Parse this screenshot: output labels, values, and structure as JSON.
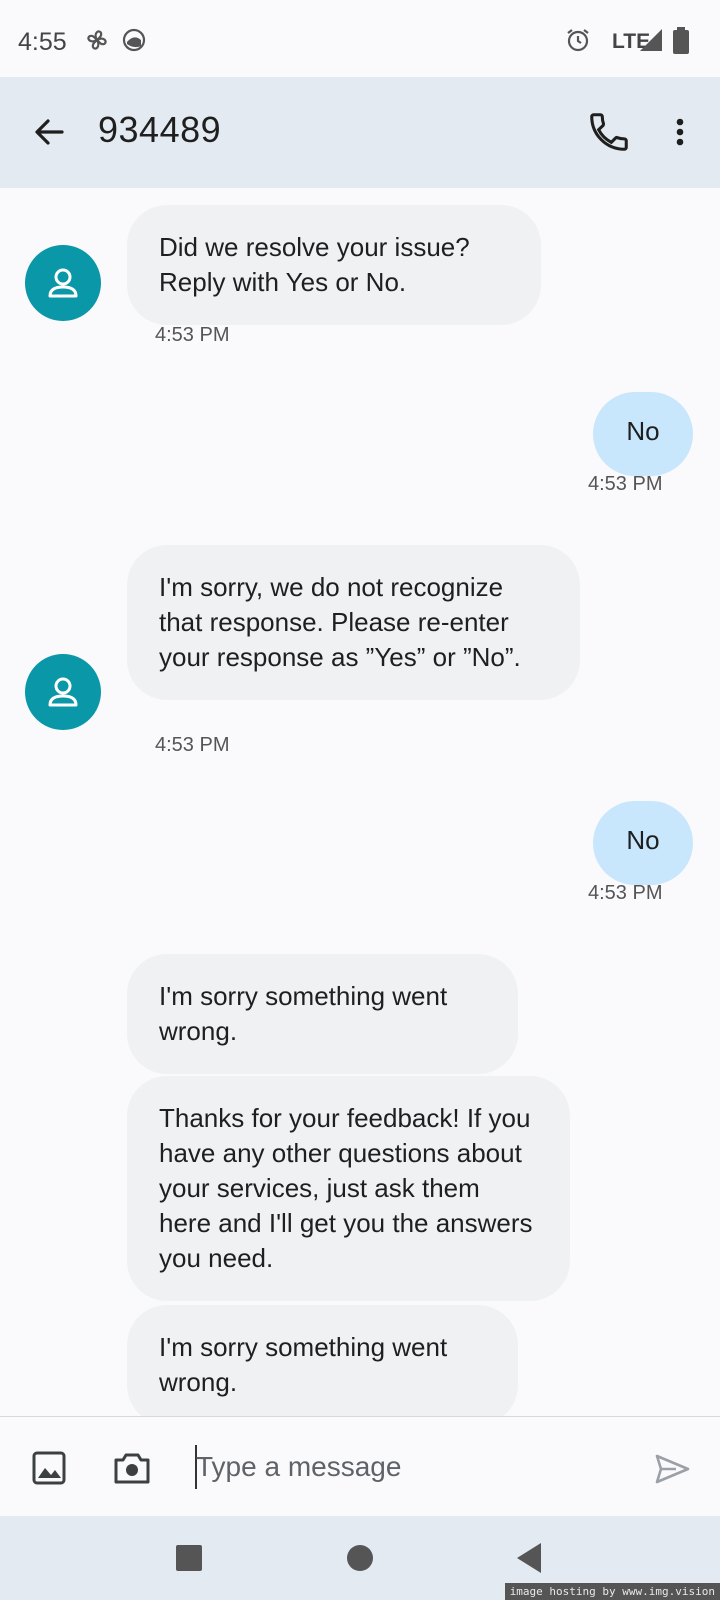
{
  "status_bar": {
    "time": "4:55",
    "network": "LTE",
    "icons": [
      "fan-icon",
      "sync-icon",
      "alarm-icon",
      "signal-icon",
      "battery-icon"
    ]
  },
  "header": {
    "title": "934489",
    "icons": [
      "back-arrow-icon",
      "phone-icon",
      "more-vert-icon"
    ]
  },
  "messages": [
    {
      "direction": "incoming",
      "text": "Did we resolve your issue? Reply with Yes or No.",
      "time": "4:53 PM"
    },
    {
      "direction": "outgoing",
      "text": "No",
      "time": "4:53 PM"
    },
    {
      "direction": "incoming",
      "text": "I'm sorry, we do not recognize that response. Please re-enter your response as ”Yes” or ”No”.",
      "time": "4:53 PM"
    },
    {
      "direction": "outgoing",
      "text": "No",
      "time": "4:53 PM"
    },
    {
      "direction": "incoming",
      "text": "I'm sorry something went wrong."
    },
    {
      "direction": "incoming",
      "text": "Thanks for your feedback! If you have any other questions about your services, just ask them here and I'll get you the answers you need."
    },
    {
      "direction": "incoming",
      "text": "I'm sorry something went wrong."
    }
  ],
  "composer": {
    "placeholder": "Type a message",
    "icons": [
      "gallery-icon",
      "camera-icon",
      "send-icon"
    ]
  },
  "nav_bar": {
    "icons": [
      "recents-icon",
      "home-icon",
      "back-icon"
    ]
  },
  "watermark": "image hosting by www.img.vision",
  "colors": {
    "app_bar": "#e4eaf1",
    "incoming_bubble": "#f0f1f3",
    "outgoing_bubble": "#c8e6fc",
    "avatar": "#0a97a7"
  }
}
